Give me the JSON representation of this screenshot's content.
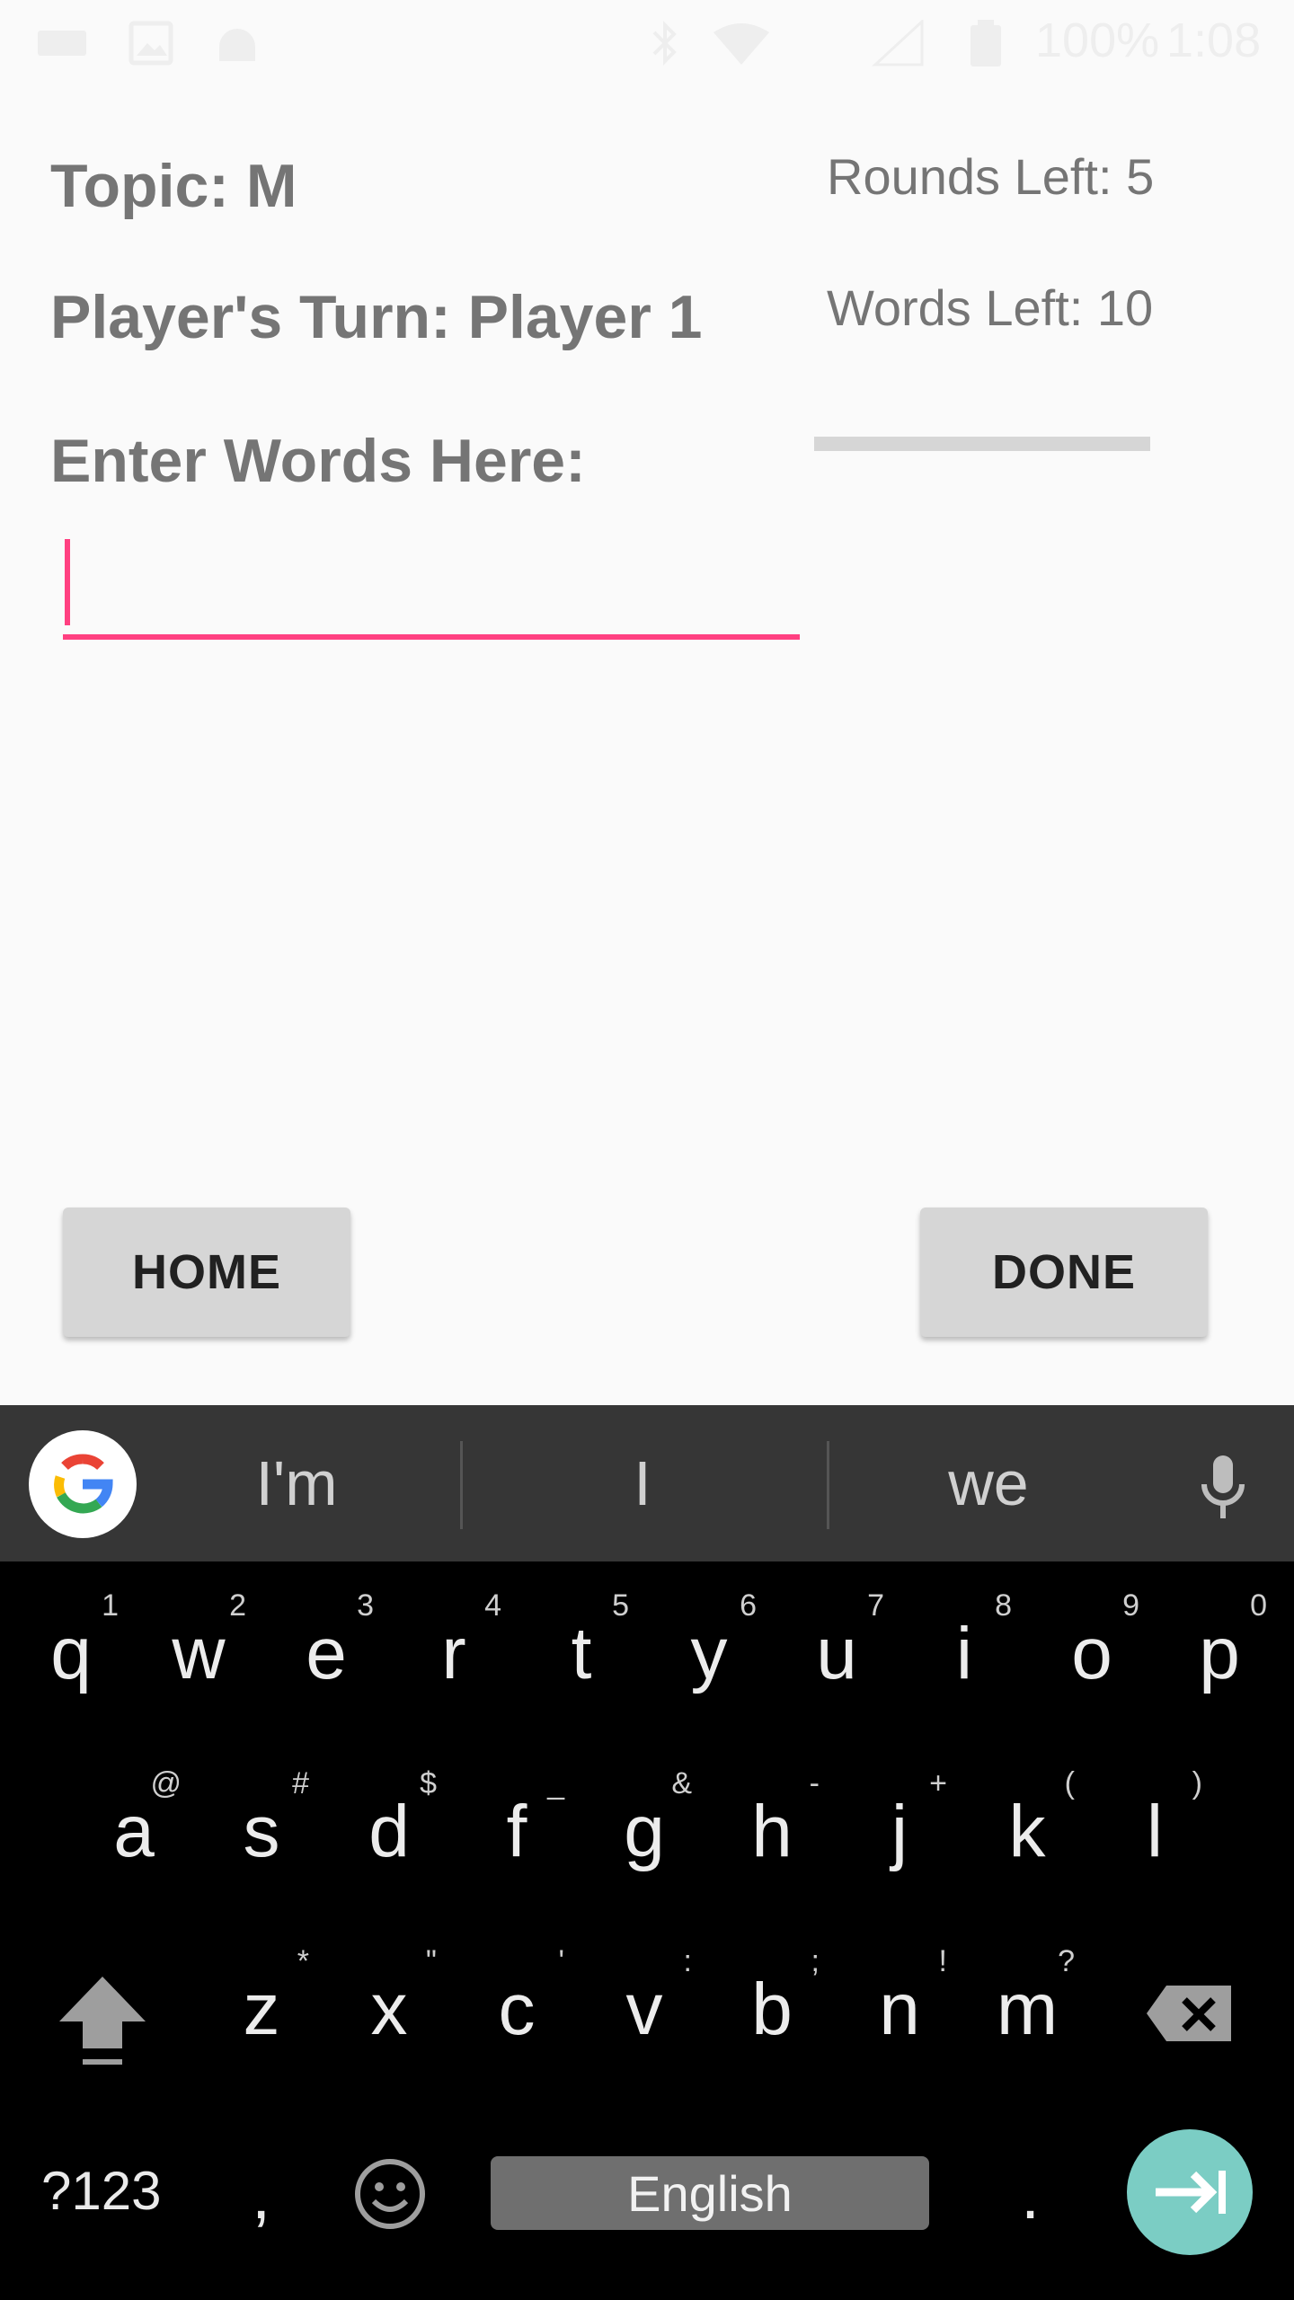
{
  "status_bar": {
    "battery": "100%",
    "time": "1:08"
  },
  "game": {
    "topic": "Topic: M",
    "player_turn": "Player's Turn: Player 1",
    "rounds_left": "Rounds Left: 5",
    "words_left": "Words Left: 10",
    "enter_label": "Enter Words Here:",
    "input_value": ""
  },
  "buttons": {
    "home": "HOME",
    "done": "DONE"
  },
  "colors": {
    "accent": "#ff4081",
    "enter_key": "#7bcdc4"
  },
  "keyboard": {
    "suggestions": [
      "I'm",
      "I",
      "we"
    ],
    "row1": [
      {
        "key": "q",
        "hint": "1"
      },
      {
        "key": "w",
        "hint": "2"
      },
      {
        "key": "e",
        "hint": "3"
      },
      {
        "key": "r",
        "hint": "4"
      },
      {
        "key": "t",
        "hint": "5"
      },
      {
        "key": "y",
        "hint": "6"
      },
      {
        "key": "u",
        "hint": "7"
      },
      {
        "key": "i",
        "hint": "8"
      },
      {
        "key": "o",
        "hint": "9"
      },
      {
        "key": "p",
        "hint": "0"
      }
    ],
    "row2": [
      {
        "key": "a",
        "hint": "@"
      },
      {
        "key": "s",
        "hint": "#"
      },
      {
        "key": "d",
        "hint": "$"
      },
      {
        "key": "f",
        "hint": "_"
      },
      {
        "key": "g",
        "hint": "&"
      },
      {
        "key": "h",
        "hint": "-"
      },
      {
        "key": "j",
        "hint": "+"
      },
      {
        "key": "k",
        "hint": "("
      },
      {
        "key": "l",
        "hint": ")"
      }
    ],
    "row3": [
      {
        "key": "z",
        "hint": "*"
      },
      {
        "key": "x",
        "hint": "\""
      },
      {
        "key": "c",
        "hint": "'"
      },
      {
        "key": "v",
        "hint": ":"
      },
      {
        "key": "b",
        "hint": ";"
      },
      {
        "key": "n",
        "hint": "!"
      },
      {
        "key": "m",
        "hint": "?"
      }
    ],
    "symbols_label": "?123",
    "comma": ",",
    "period": ".",
    "space_label": "English",
    "icons": [
      "shift-icon",
      "backspace-icon",
      "emoji-icon",
      "mic-icon",
      "enter-icon",
      "google-icon"
    ]
  }
}
